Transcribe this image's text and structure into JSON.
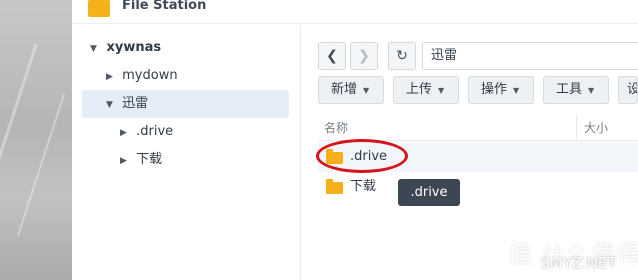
{
  "window": {
    "title": "File Station"
  },
  "sidebar": {
    "root": "xywnas",
    "items": [
      {
        "label": "mydown",
        "expanded": false
      },
      {
        "label": "迅雷",
        "expanded": true,
        "selected": true
      },
      {
        "label": ".drive",
        "expanded": false
      },
      {
        "label": "下载",
        "expanded": false
      }
    ]
  },
  "toolbar": {
    "path": "迅雷",
    "buttons": [
      "新增",
      "上传",
      "操作",
      "工具",
      "设"
    ]
  },
  "table": {
    "columns": [
      "名称",
      "大小"
    ],
    "rows": [
      {
        "name": ".drive",
        "type": "folder"
      },
      {
        "name": "下载",
        "type": "folder"
      }
    ]
  },
  "tooltip": ".drive",
  "watermark": {
    "cn": "值 什么值得买",
    "url": "SMYZ.NET"
  },
  "colors": {
    "accent_red": "#d7141b",
    "folder": "#f6b019",
    "selection": "#e5eef8"
  }
}
